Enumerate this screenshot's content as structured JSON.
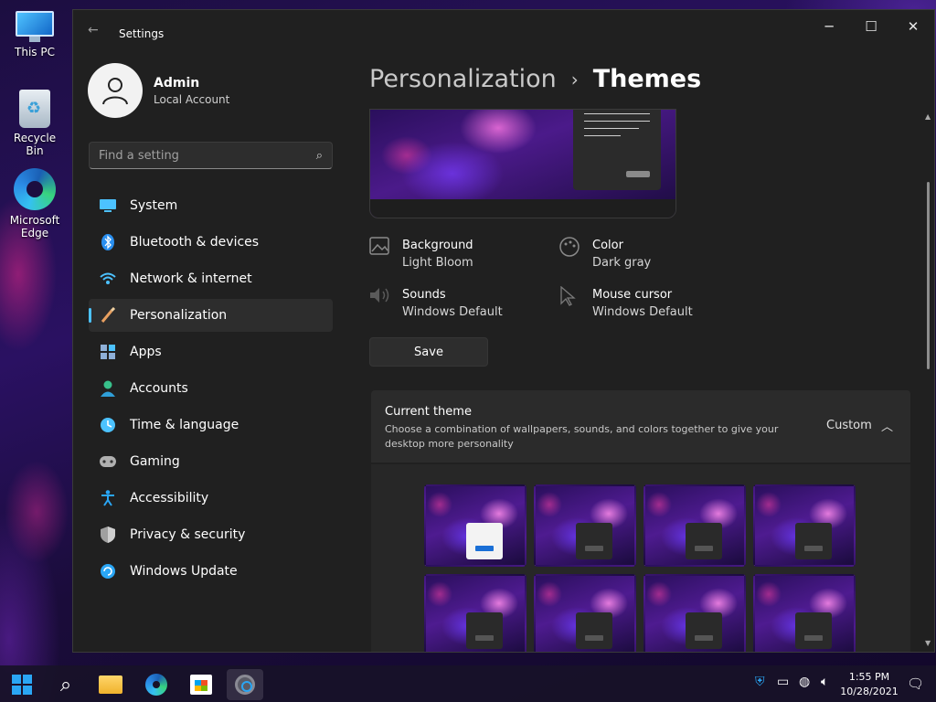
{
  "desktop": {
    "icons": [
      {
        "label": "This PC"
      },
      {
        "label": "Recycle Bin"
      },
      {
        "label": "Microsoft Edge"
      }
    ]
  },
  "window": {
    "title": "Settings",
    "controls": {
      "minimize": "─",
      "maximize": "☐",
      "close": "✕"
    },
    "back_glyph": "←"
  },
  "user": {
    "name": "Admin",
    "account": "Local Account"
  },
  "search": {
    "placeholder": "Find a setting",
    "value": ""
  },
  "sidebar": {
    "items": [
      {
        "label": "System",
        "icon": "system-icon",
        "color": "#4cc2ff"
      },
      {
        "label": "Bluetooth & devices",
        "icon": "bluetooth-icon",
        "color": "#2a8ff0"
      },
      {
        "label": "Network & internet",
        "icon": "wifi-icon",
        "color": "#4cc2ff"
      },
      {
        "label": "Personalization",
        "icon": "brush-icon",
        "color": "#e8a060",
        "active": true
      },
      {
        "label": "Apps",
        "icon": "apps-icon",
        "color": "#8fb0d8"
      },
      {
        "label": "Accounts",
        "icon": "accounts-icon",
        "color": "#38c18b"
      },
      {
        "label": "Time & language",
        "icon": "clock-globe-icon",
        "color": "#4cc2ff"
      },
      {
        "label": "Gaming",
        "icon": "gamepad-icon",
        "color": "#b0b0b0"
      },
      {
        "label": "Accessibility",
        "icon": "accessibility-icon",
        "color": "#2aa6f5"
      },
      {
        "label": "Privacy & security",
        "icon": "shield-icon",
        "color": "#a0a0a0"
      },
      {
        "label": "Windows Update",
        "icon": "update-icon",
        "color": "#2aa6f5"
      }
    ],
    "accent_color": "#4cc2ff"
  },
  "header": {
    "parent": "Personalization",
    "separator": "›",
    "current": "Themes"
  },
  "theme_props": {
    "background": {
      "label": "Background",
      "value": "Light Bloom"
    },
    "color": {
      "label": "Color",
      "value": "Dark gray"
    },
    "sounds": {
      "label": "Sounds",
      "value": "Windows Default"
    },
    "cursor": {
      "label": "Mouse cursor",
      "value": "Windows Default"
    }
  },
  "save_label": "Save",
  "current_theme": {
    "title": "Current theme",
    "description": "Choose a combination of wallpapers, sounds, and colors together to give your desktop more personality",
    "value": "Custom",
    "expanded": true
  },
  "themes": {
    "count": 8,
    "selected_index": 0
  },
  "taskbar": {
    "time": "1:55 PM",
    "date": "10/28/2021",
    "items": [
      "start-icon",
      "search-icon",
      "file-explorer-icon",
      "edge-icon",
      "store-icon",
      "settings-icon"
    ],
    "tray": [
      "defender-icon",
      "battery-icon",
      "network-icon",
      "volume-icon"
    ]
  }
}
